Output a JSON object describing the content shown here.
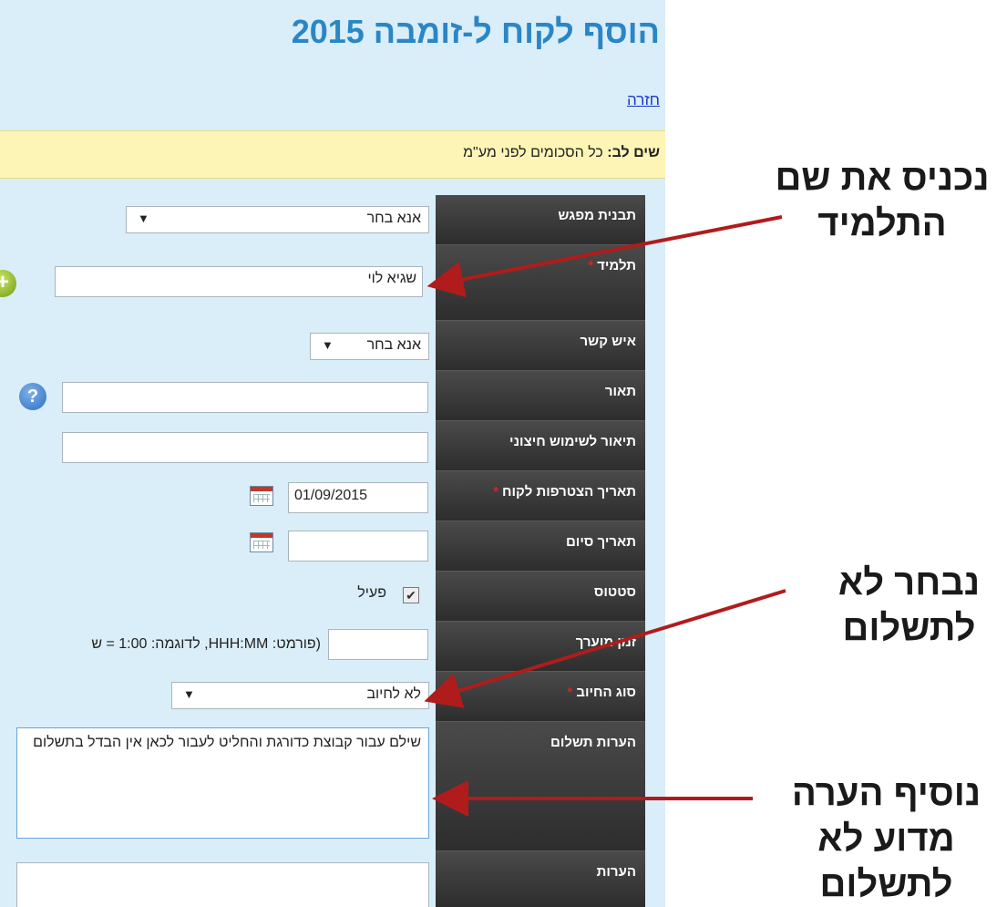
{
  "page": {
    "title": "הוסף לקוח ל-זומבה 2015",
    "back_link": "חזרה"
  },
  "notice": {
    "bold": "שים לב:",
    "text": " כל הסכומים לפני מע\"מ"
  },
  "form": {
    "meeting_template": {
      "label": "תבנית מפגש",
      "value": "אנא בחר"
    },
    "student": {
      "label": "תלמיד",
      "required_mark": "*",
      "value": "שגיא לוי"
    },
    "contact": {
      "label": "איש קשר",
      "value": "אנא בחר"
    },
    "description": {
      "label": "תאור",
      "value": ""
    },
    "external_description": {
      "label": "תיאור לשימוש חיצוני",
      "value": ""
    },
    "join_date": {
      "label": "תאריך הצטרפות לקוח",
      "required_mark": "*",
      "value": "01/09/2015"
    },
    "end_date": {
      "label": "תאריך סיום",
      "value": ""
    },
    "status": {
      "label": "סטטוס",
      "checkbox_label": "פעיל",
      "checked": true
    },
    "estimated_time": {
      "label": "זמן מוערך",
      "value": "",
      "hint": "(פורמט: HHH:MM, לדוגמה: 1:00 = ש"
    },
    "billing_type": {
      "label": "סוג החיוב",
      "required_mark": "*",
      "value": "לא לחיוב"
    },
    "payment_notes": {
      "label": "הערות תשלום",
      "value": "שילם עבור קבוצת כדורגת והחליט לעבור לכאן אין הבדל בתשלום"
    },
    "notes": {
      "label": "הערות",
      "value": ""
    }
  },
  "annotations": {
    "enter_student": "נכניס את שם התלמיד",
    "choose_no_payment": "נבחר לא לתשלום",
    "add_note": "נוסיף הערה מדוע לא לתשלום"
  },
  "colors": {
    "panel_bg": "#d9eef8",
    "title": "#2a86c6",
    "label_bg": "#3a3a3a",
    "notice_bg": "#fdf5b5",
    "required": "#e02020",
    "arrow": "#b01c1c"
  },
  "icons": {
    "add": "plus-circle-icon",
    "help": "question-icon",
    "calendar": "calendar-icon"
  }
}
